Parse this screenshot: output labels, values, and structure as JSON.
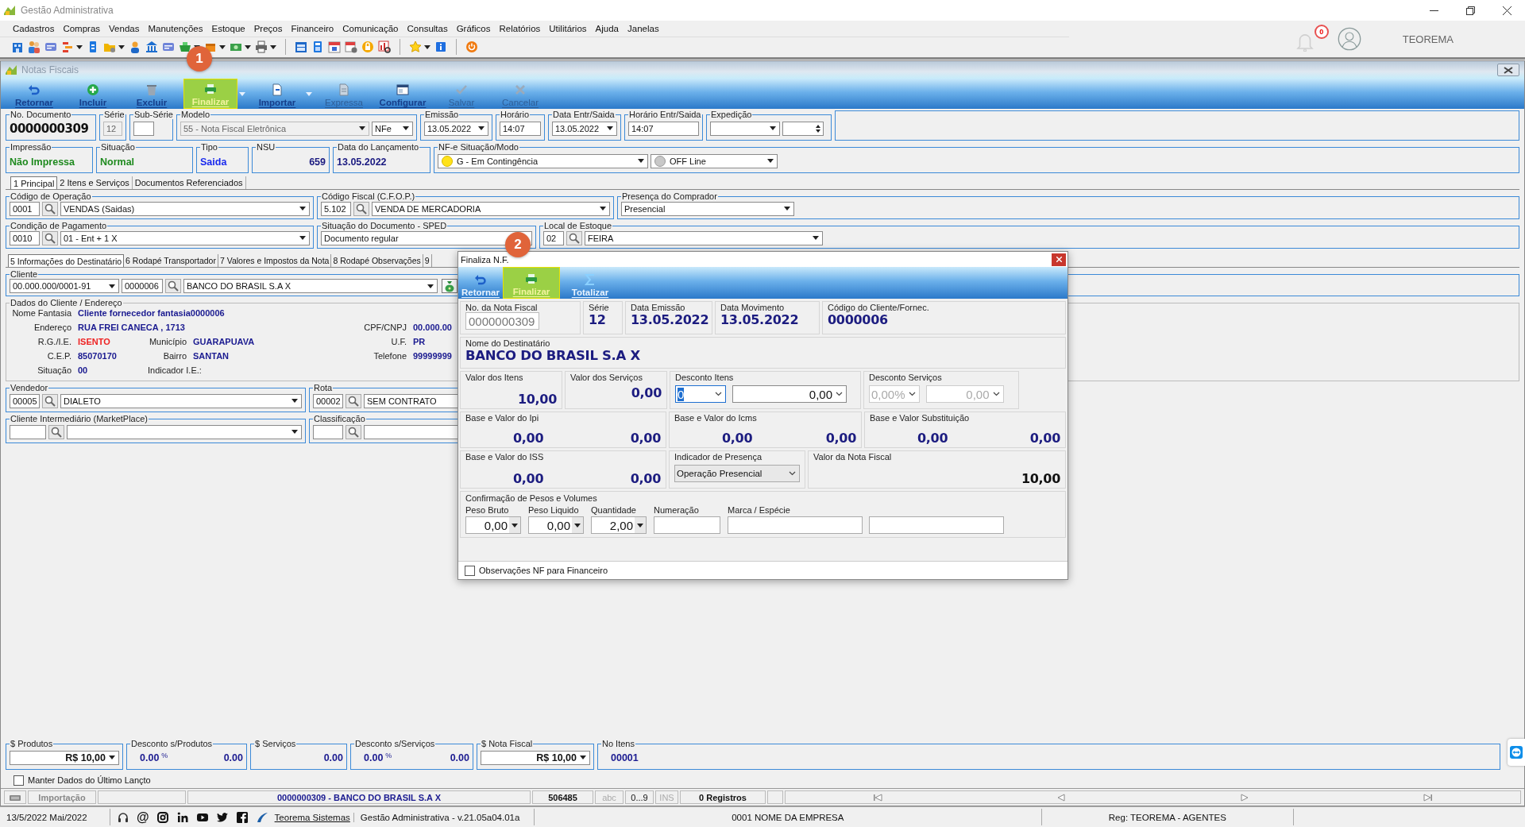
{
  "app": {
    "title": "Gestão Administrativa",
    "user": "TEOREMA",
    "notification_count": "0"
  },
  "menu": [
    "Cadastros",
    "Compras",
    "Vendas",
    "Manutenções",
    "Estoque",
    "Preços",
    "Financeiro",
    "Comunicação",
    "Consultas",
    "Gráficos",
    "Relatórios",
    "Utilitários",
    "Ajuda",
    "Janelas"
  ],
  "window": {
    "title": "Notas Fiscais"
  },
  "toolbar": [
    {
      "label": "Retornar",
      "kind": "back",
      "disabled": false,
      "highlighted": false,
      "dropdown": false
    },
    {
      "label": "Incluir",
      "kind": "plus",
      "disabled": false,
      "highlighted": false,
      "dropdown": false
    },
    {
      "label": "Excluir",
      "kind": "trash",
      "disabled": false,
      "highlighted": false,
      "dropdown": false
    },
    {
      "label": "Finalizar",
      "kind": "print",
      "disabled": false,
      "highlighted": true,
      "dropdown": true
    },
    {
      "label": "Importar",
      "kind": "import",
      "disabled": false,
      "highlighted": false,
      "dropdown": true
    },
    {
      "label": "Expressa",
      "kind": "edit",
      "disabled": true,
      "highlighted": false,
      "dropdown": false
    },
    {
      "label": "Configurar",
      "kind": "config",
      "disabled": false,
      "highlighted": false,
      "dropdown": false
    },
    {
      "label": "Salvar",
      "kind": "check",
      "disabled": true,
      "highlighted": false,
      "dropdown": false
    },
    {
      "label": "Cancelar",
      "kind": "cross",
      "disabled": true,
      "highlighted": false,
      "dropdown": false
    }
  ],
  "annotations": [
    {
      "label": "1"
    },
    {
      "label": "2"
    }
  ],
  "header": {
    "document_number": {
      "label": "No. Documento",
      "value": "0000000309"
    },
    "serie": {
      "label": "Série",
      "value": "12"
    },
    "sub_serie": {
      "label": "Sub-Série"
    },
    "modelo": {
      "label": "Modelo",
      "value": "55 - Nota Fiscal Eletrônica",
      "type": "NFe"
    },
    "emissao": {
      "label": "Emissão",
      "value": "13.05.2022"
    },
    "horario": {
      "label": "Horário",
      "value": "14:07"
    },
    "data_entr_saida": {
      "label": "Data Entr/Saida",
      "value": "13.05.2022"
    },
    "horario_entr_saida": {
      "label": "Horário Entr/Saida",
      "value": "14:07"
    },
    "expedicao": {
      "label": "Expedição"
    }
  },
  "status": {
    "impressao": {
      "label": "Impressão",
      "value": "Não Impressa"
    },
    "situacao": {
      "label": "Situação",
      "value": "Normal"
    },
    "tipo": {
      "label": "Tipo",
      "value": "Saida"
    },
    "nsu": {
      "label": "NSU",
      "value": "659"
    },
    "data_lancamento": {
      "label": "Data do Lançamento",
      "value": "13.05.2022"
    },
    "nfe_modo": {
      "label": "NF-e Situação/Modo",
      "situacao": "G - Em Contingência",
      "modo": "OFF Line"
    }
  },
  "tabs": [
    {
      "label": "1 Principal",
      "selected": true
    },
    {
      "label": "2 Itens e Serviços",
      "selected": false
    },
    {
      "label": "Documentos Referenciados",
      "selected": false
    }
  ],
  "principal": {
    "operacao": {
      "label": "Código de Operação",
      "code": "0001",
      "value": "VENDAS (Saidas)"
    },
    "cfop": {
      "label": "Código Fiscal (C.F.O.P.)",
      "code": "5.102",
      "value": "VENDA DE MERCADORIA"
    },
    "presenca": {
      "label": "Presença do Comprador",
      "value": "Presencial"
    },
    "pagamento": {
      "label": "Condição de Pagamento",
      "code": "0010",
      "value": "01 - Ent + 1 X"
    },
    "sped": {
      "label": "Situação do Documento - SPED",
      "value": "Documento regular"
    },
    "estoque": {
      "label": "Local de Estoque",
      "code": "02",
      "value": "FEIRA"
    }
  },
  "subtabs": [
    {
      "label": "5 Informações do Destinatário",
      "selected": true
    },
    {
      "label": "6 Rodapé Transportador",
      "selected": false
    },
    {
      "label": "7 Valores e Impostos da Nota",
      "selected": false
    },
    {
      "label": "8 Rodapé Observações",
      "selected": false
    },
    {
      "label": "9",
      "selected": false
    }
  ],
  "cliente": {
    "label": "Cliente",
    "cnpj": "00.000.000/0001-91",
    "code": "0000006",
    "name": "BANCO DO BRASIL S.A X"
  },
  "dados": {
    "label": "Dados do Cliente / Endereço",
    "nome_fantasia": {
      "label": "Nome Fantasia",
      "value": "Cliente fornecedor fantasia0000006"
    },
    "endereco": {
      "label": "Endereço",
      "value": "RUA FREI CANECA , 1713"
    },
    "cpf_cnpj": {
      "label": "CPF/CNPJ",
      "value": "00.000.00"
    },
    "rg_ie": {
      "label": "R.G./I.E.",
      "value": "ISENTO"
    },
    "municipio": {
      "label": "Município",
      "value": "GUARAPUAVA"
    },
    "uf": {
      "label": "U.F.",
      "value": "PR"
    },
    "cep": {
      "label": "C.E.P.",
      "value": "85070170"
    },
    "bairro": {
      "label": "Bairro",
      "value": "SANTAN"
    },
    "telefone": {
      "label": "Telefone",
      "value": "99999999"
    },
    "situacao": {
      "label": "Situação",
      "value": "00"
    },
    "indicador_ie": {
      "label": "Indicador I.E.:"
    }
  },
  "vendedor": {
    "label": "Vendedor",
    "code": "00005",
    "value": "DIALETO"
  },
  "rota": {
    "label": "Rota",
    "code": "00002",
    "value": "SEM CONTRATO"
  },
  "intermediario": {
    "label": "Cliente Intermediário (MarketPlace)"
  },
  "classificacao": {
    "label": "Classificação"
  },
  "totals": {
    "produtos": {
      "label": "$ Produtos",
      "value": "R$ 10,00"
    },
    "desconto_produtos": {
      "label": "Desconto s/Produtos",
      "percent": "0.00",
      "percent_sign": "%",
      "value": "0.00"
    },
    "servicos": {
      "label": "$ Serviços",
      "value": "0.00"
    },
    "desconto_servicos": {
      "label": "Desconto s/Serviços",
      "percent": "0.00",
      "percent_sign": "%",
      "value": "0.00"
    },
    "nota_fiscal": {
      "label": "$ Nota Fiscal",
      "value": "R$ 10,00"
    },
    "itens": {
      "label": "No Itens",
      "value": "00001"
    }
  },
  "manter": {
    "label": "Manter Dados do Último Lançto",
    "checked": false
  },
  "status_bar": {
    "origin": "Importação",
    "document": "0000000309 - BANCO DO BRASIL S.A X",
    "number": "506485",
    "caps": "abc",
    "num": "0...9",
    "ins": "INS",
    "records": "0 Registros"
  },
  "footer": {
    "date": "13/5/2022 Mai/2022",
    "at_sign": "@",
    "link": "Teorema Sistemas",
    "version": "Gestão Administrativa - v.21.05a04.01a",
    "company": "0001 NOME DA EMPRESA",
    "registration": "Reg: TEOREMA - AGENTES"
  },
  "dialog": {
    "title": "Finaliza N.F.",
    "toolbar": [
      {
        "label": "Retornar",
        "kind": "back",
        "highlighted": false
      },
      {
        "label": "Finalizar",
        "kind": "print",
        "highlighted": true
      },
      {
        "label": "Totalizar",
        "kind": "sigma",
        "highlighted": false
      }
    ],
    "numero": {
      "label": "No. da Nota Fiscal",
      "value": "0000000309"
    },
    "serie": {
      "label": "Série",
      "value": "12"
    },
    "data_emissao": {
      "label": "Data Emissão",
      "value": "13.05.2022"
    },
    "data_movimento": {
      "label": "Data Movimento",
      "value": "13.05.2022"
    },
    "codigo_cliente": {
      "label": "Código do Cliente/Fornec.",
      "value": "0000006"
    },
    "destinatario": {
      "label": "Nome do Destinatário",
      "value": "BANCO DO BRASIL S.A X"
    },
    "valor_itens": {
      "label": "Valor dos Itens",
      "value": "10,00"
    },
    "valor_servicos": {
      "label": "Valor dos Serviços",
      "value": "0,00"
    },
    "desconto_itens": {
      "label": "Desconto Itens",
      "type": "0",
      "value": "0,00"
    },
    "desconto_servicos": {
      "label": "Desconto Serviços",
      "percent": "0,00%",
      "value": "0,00",
      "disabled": true
    },
    "ipi": {
      "label": "Base e Valor do Ipi",
      "base": "0,00",
      "value": "0,00"
    },
    "icms": {
      "label": "Base e Valor do Icms",
      "base": "0,00",
      "value": "0,00"
    },
    "substituicao": {
      "label": "Base e Valor Substituição",
      "base": "0,00",
      "value": "0,00"
    },
    "iss": {
      "label": "Base e Valor do ISS",
      "base": "0,00",
      "value": "0,00"
    },
    "indicador_presenca": {
      "label": "Indicador de Presença",
      "value": "Operação Presencial"
    },
    "valor_nota": {
      "label": "Valor da Nota Fiscal",
      "value": "10,00"
    },
    "pesos": {
      "label": "Confirmação de Pesos e Volumes",
      "peso_bruto": {
        "label": "Peso Bruto",
        "value": "0,00"
      },
      "peso_liquido": {
        "label": "Peso Liquido",
        "value": "0,00"
      },
      "quantidade": {
        "label": "Quantidade",
        "value": "2,00"
      },
      "numeracao": {
        "label": "Numeração"
      },
      "marca": {
        "label": "Marca / Espécie"
      }
    },
    "observacoes": {
      "label": "Observações NF para Financeiro",
      "checked": false
    }
  }
}
